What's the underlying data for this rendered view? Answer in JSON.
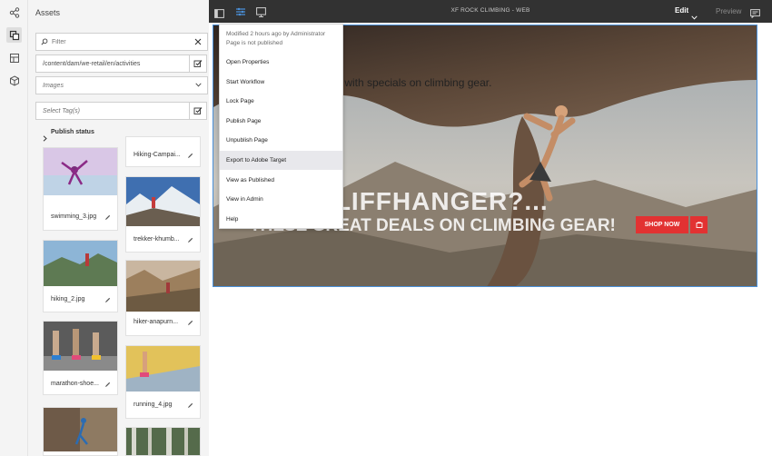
{
  "topbar": {
    "title": "XF ROCK CLIMBING - WEB",
    "mode": "Edit",
    "preview": "Preview"
  },
  "assets_panel": {
    "title": "Assets",
    "filter_placeholder": "Filter",
    "path": "/content/dam/we-retail/en/activities",
    "type_select": "Images",
    "tags_placeholder": "Select Tag(s)",
    "publish_status": "Publish status",
    "left_column": [
      {
        "name": "swimming_3.jpg"
      },
      {
        "name": "hiking_2.jpg"
      },
      {
        "name": "marathon-shoe..."
      }
    ],
    "right_column": [
      {
        "name": "Hiking-Campai..."
      },
      {
        "name": "trekker-khumb..."
      },
      {
        "name": "hiker-anapurn..."
      },
      {
        "name": "running_4.jpg"
      }
    ]
  },
  "context_menu": {
    "modified": "Modified 2 hours ago by Administrator",
    "status": "Page is not published",
    "items": [
      "Open Properties",
      "Start Workflow",
      "Lock Page",
      "Publish Page",
      "Unpublish Page",
      "Export to Adobe Target",
      "View as Published",
      "View in Admin",
      "Help"
    ],
    "highlighted_index": 5
  },
  "hero": {
    "subtext": "s with specials on climbing gear.",
    "headline": "AL CLIFFHANGER?...",
    "subheadline": "THESE GREAT DEALS ON CLIMBING GEAR!",
    "cta": "SHOP NOW"
  },
  "colors": {
    "topbar_bg": "#323232",
    "panel_bg": "#f4f4f4",
    "selection_border": "#4a90d9",
    "cta": "#e23232"
  }
}
